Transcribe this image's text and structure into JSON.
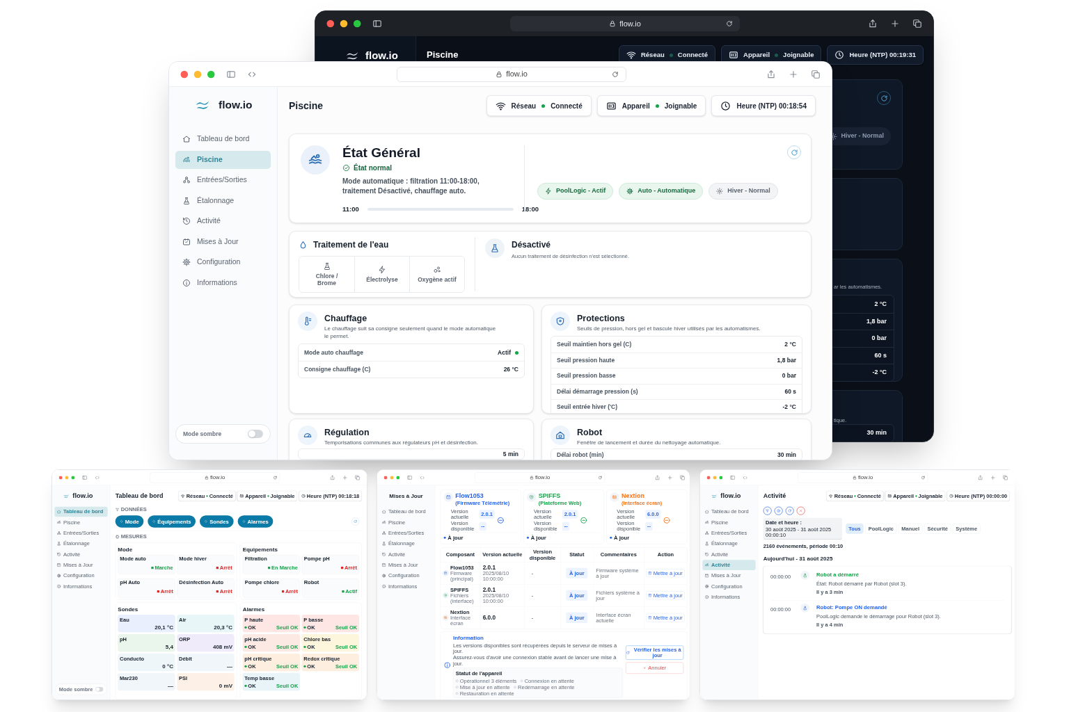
{
  "dark_window": {
    "url": "flow.io",
    "logo": "flow.io",
    "page_title": "Piscine",
    "status": [
      {
        "label": "Réseau",
        "value": "Connecté",
        "ok": true
      },
      {
        "label": "Appareil",
        "value": "Joignable",
        "ok": true
      }
    ],
    "clock": "Heure (NTP) 00:19:31",
    "mode_chip": "Hiver - Normal",
    "protections_tail": "ar les automatismes.",
    "protection_values": [
      "2 °C",
      "1,8 bar",
      "0 bar",
      "60 s",
      "-2 °C"
    ],
    "robot_tail": "tique.",
    "robot_value": "30 min"
  },
  "main_window": {
    "url": "flow.io",
    "logo": "flow.io",
    "nav": [
      {
        "label": "Tableau de bord",
        "selected": false
      },
      {
        "label": "Piscine",
        "selected": true
      },
      {
        "label": "Entrées/Sorties",
        "selected": false
      },
      {
        "label": "Étalonnage",
        "selected": false
      },
      {
        "label": "Activité",
        "selected": false
      },
      {
        "label": "Mises à Jour",
        "selected": false
      },
      {
        "label": "Configuration",
        "selected": false
      },
      {
        "label": "Informations",
        "selected": false
      }
    ],
    "dark_mode": {
      "label": "Mode sombre",
      "on": false
    },
    "page_title": "Piscine",
    "status": [
      {
        "label": "Réseau",
        "value": "Connecté",
        "ok": true
      },
      {
        "label": "Appareil",
        "value": "Joignable",
        "ok": true
      }
    ],
    "clock": "Heure (NTP) 00:18:54",
    "general": {
      "title": "État Général",
      "state": "État normal",
      "description": "Mode automatique : filtration 11:00-18:00, traitement Désactivé, chauffage auto.",
      "start": "11:00",
      "end": "18:00",
      "level": 0,
      "chips": [
        {
          "label": "PoolLogic - Actif",
          "active": true
        },
        {
          "label": "Auto - Automatique",
          "active": true
        },
        {
          "label": "Hiver - Normal",
          "active": false
        }
      ]
    },
    "treatment": {
      "title": "Traitement de l'eau",
      "options": [
        {
          "label": "Chlore / Brome",
          "selected": false
        },
        {
          "label": "Électrolyse",
          "selected": false
        },
        {
          "label": "Oxygène actif",
          "selected": false
        }
      ],
      "status_title": "Désactivé",
      "status_text": "Aucun traitement de désinfection n'est sélectionné."
    },
    "heating": {
      "title": "Chauffage",
      "description": "Le chauffage suit sa consigne seulement quand le mode automatique le permet.",
      "rows": [
        {
          "label": "Mode auto chauffage",
          "value": "Actif",
          "on": true
        },
        {
          "label": "Consigne chauffage (C)",
          "value": "26 °C"
        }
      ]
    },
    "protections": {
      "title": "Protections",
      "description": "Seuils de pression, hors gel et bascule hiver utilisés par les automatismes.",
      "rows": [
        {
          "label": "Seuil maintien hors gel (C)",
          "value": "2 °C"
        },
        {
          "label": "Seuil pression haute",
          "value": "1,8 bar"
        },
        {
          "label": "Seuil pression basse",
          "value": "0 bar"
        },
        {
          "label": "Délai démarrage pression (s)",
          "value": "60 s"
        },
        {
          "label": "Seuil entrée hiver ('C)",
          "value": "-2 °C"
        }
      ]
    },
    "regulation": {
      "title": "Régulation",
      "description": "Temporisations communes aux régulateurs pH et désinfection.",
      "value": "5 min"
    },
    "robot": {
      "title": "Robot",
      "description": "Fenêtre de lancement et durée du nettoyage automatique.",
      "row_label": "Délai robot (min)",
      "value": "30 min"
    }
  },
  "dashboard_window": {
    "url": "flow.io",
    "logo": "flow.io",
    "nav": [
      {
        "label": "Tableau de bord",
        "selected": true
      },
      {
        "label": "Piscine",
        "selected": false
      },
      {
        "label": "Entrées/Sorties",
        "selected": false
      },
      {
        "label": "Étalonnage",
        "selected": false
      },
      {
        "label": "Activité",
        "selected": false
      },
      {
        "label": "Mises à Jour",
        "selected": false
      },
      {
        "label": "Configuration",
        "selected": false
      },
      {
        "label": "Informations",
        "selected": false
      }
    ],
    "dark_mode": {
      "label": "Mode sombre",
      "on": false
    },
    "page_title": "Tableau de bord",
    "status": [
      {
        "label": "Réseau",
        "value": "Connecté",
        "ok": true
      },
      {
        "label": "Appareil",
        "value": "Joignable",
        "ok": true
      }
    ],
    "clock": "Heure (NTP) 00:18:18",
    "data_label": "DONNÉES",
    "shortcuts": [
      "Mode",
      "Équipements",
      "Sondes",
      "Alarmes"
    ],
    "measures_label": "MESURES",
    "groups": [
      {
        "title": "Mode",
        "items": [
          {
            "label": "Mode auto",
            "value": "Marche",
            "on": true
          },
          {
            "label": "Mode hiver",
            "value": "Arrêt",
            "on": false
          },
          {
            "label": "pH Auto",
            "value": "Arrêt",
            "on": false
          },
          {
            "label": "Désinfection Auto",
            "value": "Arrêt",
            "on": false
          }
        ]
      },
      {
        "title": "Equipements",
        "items": [
          {
            "label": "Filtration",
            "value": "En Marche",
            "on": true
          },
          {
            "label": "Pompe pH",
            "value": "Arrêt",
            "on": false
          },
          {
            "label": "Pompe chlore",
            "value": "Arrêt",
            "on": false
          },
          {
            "label": "Robot",
            "value": "Actif",
            "on": true
          }
        ]
      }
    ],
    "probes": {
      "title": "Sondes",
      "items": [
        {
          "label": "Eau",
          "value": "20,1 °C",
          "color": "#e9effc"
        },
        {
          "label": "Air",
          "value": "20,3 °C",
          "color": "#e8f6f8"
        },
        {
          "label": "pH",
          "value": "5,4",
          "color": "#eaf6ec"
        },
        {
          "label": "ORP",
          "value": "408 mV",
          "color": "#efebfa"
        },
        {
          "label": "Conducto",
          "value": "0 °C",
          "color": "#eef6fa"
        },
        {
          "label": "Débit",
          "value": "—",
          "color": "#f1f6fa"
        },
        {
          "label": "Mar230",
          "value": "—",
          "color": "#f1f6fa"
        },
        {
          "label": "PSI",
          "value": "0 mV",
          "color": "#fdf0e6"
        }
      ]
    },
    "alarms": {
      "title": "Alarmes",
      "items": [
        {
          "label": "P haute",
          "state": "OK",
          "threshold": "Seuil OK",
          "color": "#fde6e3"
        },
        {
          "label": "P basse",
          "state": "OK",
          "threshold": "Seuil OK",
          "color": "#fde6e3"
        },
        {
          "label": "pH acide",
          "state": "OK",
          "threshold": "Seuil OK",
          "color": "#fde9e3"
        },
        {
          "label": "Chlore bas",
          "state": "OK",
          "threshold": "Seuil OK",
          "color": "#fdf5dc"
        },
        {
          "label": "pH critique",
          "state": "OK",
          "threshold": "Seuil OK",
          "color": "#fdeee0"
        },
        {
          "label": "Redox critique",
          "state": "OK",
          "threshold": "Seuil OK",
          "color": "#fdeee0"
        },
        {
          "label": "Temp basse",
          "state": "OK",
          "threshold": "Seuil OK",
          "color": "#e8f4f8"
        }
      ]
    }
  },
  "updates_window": {
    "url": "flow.io",
    "sidebar_title": "Mises à Jour",
    "nav": [
      {
        "label": "Tableau de bord",
        "selected": false
      },
      {
        "label": "Piscine",
        "selected": false
      },
      {
        "label": "Entrées/Sorties",
        "selected": false
      },
      {
        "label": "Étalonnage",
        "selected": false
      },
      {
        "label": "Activité",
        "selected": false
      },
      {
        "label": "Mises à Jour",
        "selected": false
      },
      {
        "label": "Configuration",
        "selected": false
      },
      {
        "label": "Informations",
        "selected": false
      }
    ],
    "components": [
      {
        "name": "Flow1053",
        "subtitle": "(Firmware Télémétrie)",
        "color": "#2563eb",
        "current_label": "Version actuelle",
        "current": "2.0.1",
        "available_label": "Version disponible",
        "available": "--",
        "status": "À jour"
      },
      {
        "name": "SPIFFS",
        "subtitle": "(Plateforme Web)",
        "color": "#16a34a",
        "current_label": "Version actuelle",
        "current": "2.0.1",
        "available_label": "Version disponible",
        "available": "--",
        "status": "À jour"
      },
      {
        "name": "Nextion",
        "subtitle": "(Interface écran)",
        "color": "#f97316",
        "current_label": "Version actuelle",
        "current": "6.0.0",
        "available_label": "Version disponible",
        "available": "--",
        "status": "À jour"
      }
    ],
    "columns": [
      "Composant",
      "Version actuelle",
      "Version disponible",
      "Statut",
      "Commentaires",
      "Action"
    ],
    "rows": [
      {
        "name": "Flow1053",
        "detail": "Firmware (principal)",
        "version": "2.0.1",
        "date": "2025/08/10 10:00:00",
        "available": "-",
        "status": "À jour",
        "comment": "Firmware système à jour",
        "action": "Mettre à jour"
      },
      {
        "name": "SPIFFS",
        "detail": "Fichiers (interface)",
        "version": "2.0.1",
        "date": "2025/08/10 10:00:00",
        "available": "-",
        "status": "À jour",
        "comment": "Fichiers système à jour",
        "action": "Mettre à jour"
      },
      {
        "name": "Nextion",
        "detail": "Interface écran",
        "version": "6.0.0",
        "available": "-",
        "status": "À jour",
        "comment": "Interface écran actuelle",
        "action": "Mettre à jour"
      }
    ],
    "info": {
      "title": "Information",
      "lines": [
        "Les versions disponibles sont récupérées depuis le serveur de mises à jour.",
        "Assurez-vous d'avoir une connexion stable avant de lancer une mise à jour."
      ],
      "device_status_title": "Statut de l'appareil",
      "steps": [
        "Opérationnel 3 éléments",
        "Connexion en attente",
        "Mise à jour en attente",
        "Redémarrage en attente",
        "Restauration en attente"
      ],
      "check_button": "Vérifier les mises à jour",
      "cancel_button": "Annuler"
    }
  },
  "activity_window": {
    "url": "flow.io",
    "logo": "flow.io",
    "nav": [
      {
        "label": "Tableau de bord",
        "selected": false
      },
      {
        "label": "Piscine",
        "selected": false
      },
      {
        "label": "Entrées/Sorties",
        "selected": false
      },
      {
        "label": "Étalonnage",
        "selected": false
      },
      {
        "label": "Activité",
        "selected": false
      },
      {
        "label": "Activité",
        "selected": true
      },
      {
        "label": "Mises à Jour",
        "selected": false
      },
      {
        "label": "Configuration",
        "selected": false
      },
      {
        "label": "Informations",
        "selected": false
      }
    ],
    "page_title": "Activité",
    "status": [
      {
        "label": "Réseau",
        "value": "Connecté",
        "ok": true
      },
      {
        "label": "Appareil",
        "value": "Joignable",
        "ok": true
      }
    ],
    "clock": "Heure (NTP) 00:00:00",
    "date_label": "Date et heure :",
    "date_range": "30 août 2025 - 31 août 2025 00:00:10",
    "filters": [
      {
        "label": "Tous",
        "selected": true
      },
      {
        "label": "PoolLogic",
        "selected": false
      },
      {
        "label": "Manuel",
        "selected": false
      },
      {
        "label": "Sécurité",
        "selected": false
      },
      {
        "label": "Système",
        "selected": false
      }
    ],
    "summary": "2160 événements, période 00:10",
    "day": "Aujourd'hui - 31 août 2025",
    "events": [
      {
        "time": "00:00:00",
        "title": "Robot a démarré",
        "text": "État: Robot démarré par Robot (slot 3).",
        "ago": "Il y a 3 min",
        "color": "#16a34a"
      },
      {
        "time": "00:00:00",
        "title": "Robot: Pompe ON demandé",
        "text": "PoolLogic demande le démarrage pour Robot (slot 3).",
        "ago": "Il y a 4 min",
        "color": "#2563eb"
      }
    ]
  }
}
